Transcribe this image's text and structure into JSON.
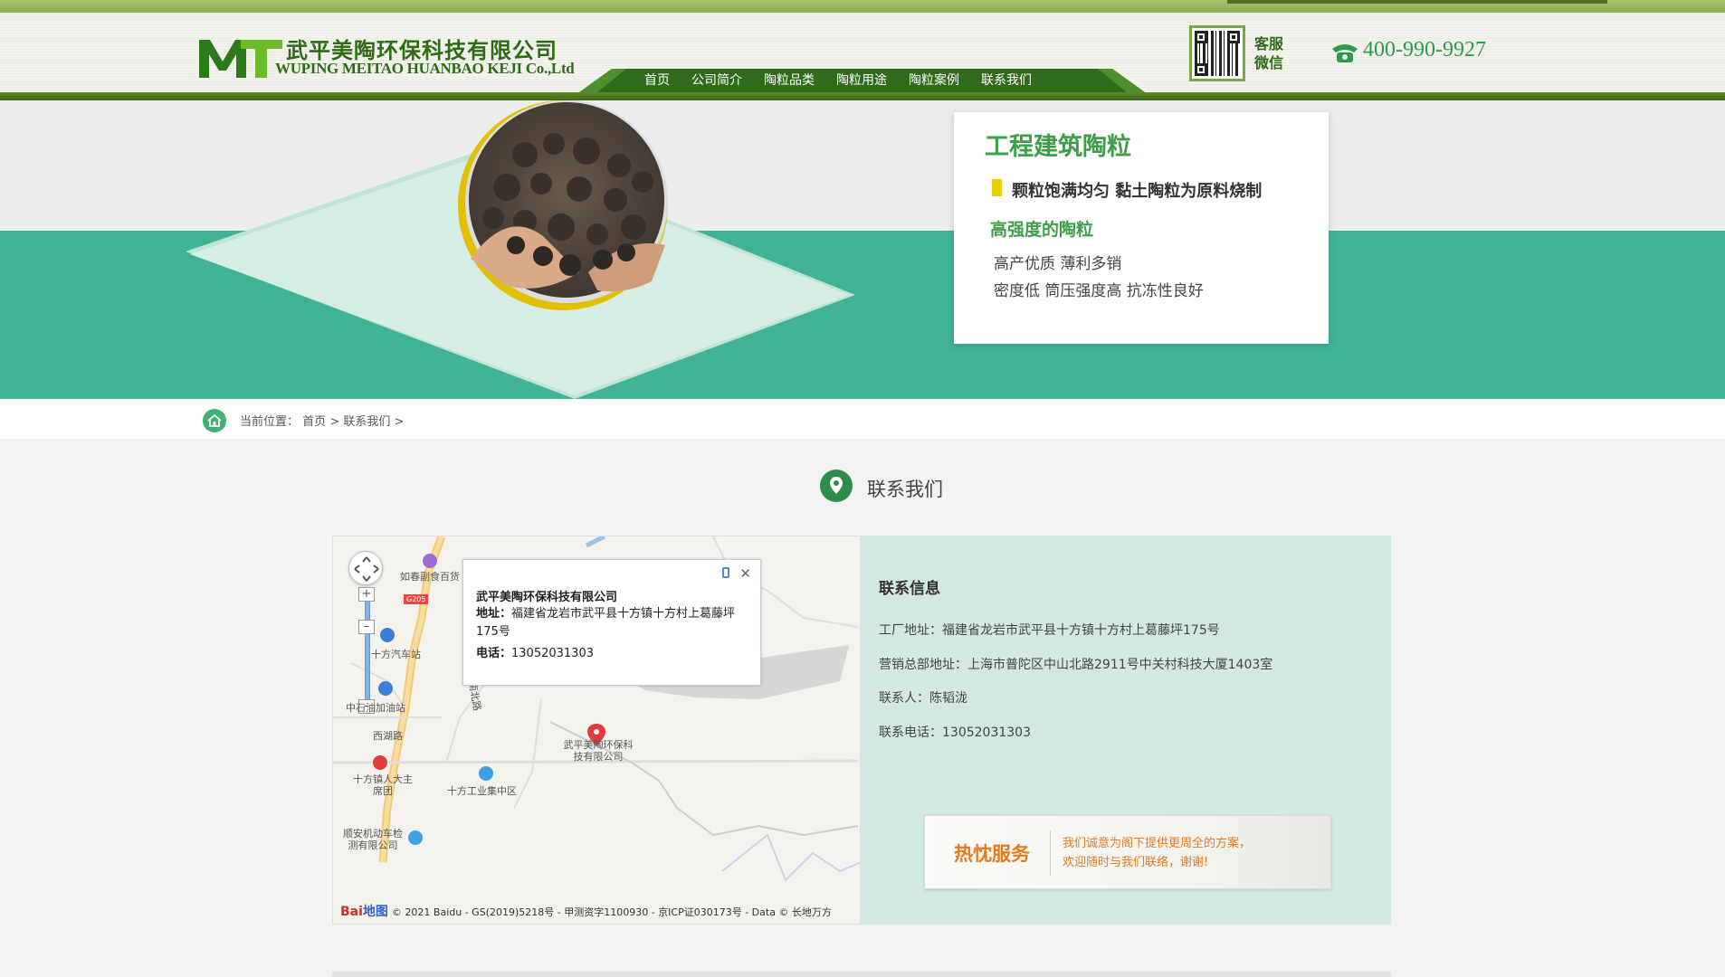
{
  "header": {
    "company_cn": "武平美陶环保科技有限公司",
    "company_en": "WUPING MEITAO HUANBAO KEJI Co.,Ltd",
    "qr_label": "客服微信",
    "phone": "400-990-9927",
    "nav": [
      "首页",
      "公司简介",
      "陶粒品类",
      "陶粒用途",
      "陶粒案例",
      "联系我们"
    ]
  },
  "banner": {
    "title": "工程建筑陶粒",
    "line1": "颗粒饱满均匀  黏土陶粒为原料烧制",
    "subtitle": "高强度的陶粒",
    "line2": "高产优质   薄利多销",
    "line3": "密度低  筒压强度高   抗冻性良好",
    "colors": {
      "green": "#40b295",
      "accent": "#3da048",
      "bar": "#e8d000"
    }
  },
  "breadcrumb": {
    "label": "当前位置：",
    "home": "首页",
    "sep": ">",
    "current": "联系我们"
  },
  "section_title": "联系我们",
  "map": {
    "popup": {
      "title": "武平美陶环保科技有限公司",
      "addr_label": "地址：",
      "addr": "福建省龙岩市武平县十方镇十方村上葛藤坪175号",
      "tel_label": "电话：",
      "tel": "13052031303"
    },
    "labels": {
      "store": "如春副食百货",
      "road_g": "G205",
      "bus": "十方汽车站",
      "gas": "中石油加油站",
      "xihu": "西湖路",
      "gov": "十方镇人大主席团",
      "industry": "十方工业集中区",
      "vehicle": "顺安机动车检测有限公司",
      "company": "武平美陶环保科技有限公司",
      "road_n": "南北路"
    },
    "footer": "© 2021 Baidu - GS(2019)5218号 - 甲测资字1100930 - 京ICP证030173号 - Data © 长地万方",
    "logo": {
      "a": "Bai",
      "b": "地图"
    }
  },
  "info": {
    "title": "联系信息",
    "lines": [
      "工厂地址：福建省龙岩市武平县十方镇十方村上葛藤坪175号",
      "营销总部地址：上海市普陀区中山北路2911号中关村科技大厦1403室",
      "联系人：陈韬泷",
      "联系电话：13052031303"
    ],
    "service": {
      "title": "热忱服务",
      "text1": "我们诚意为阁下提供更周全的方案，",
      "text2": "欢迎随时与我们联络，谢谢!"
    }
  },
  "icons": [
    "logo-mark",
    "qr-code",
    "phone-icon",
    "home-icon",
    "location-pin-icon",
    "map-nav-icon",
    "close-icon",
    "mobile-icon"
  ]
}
